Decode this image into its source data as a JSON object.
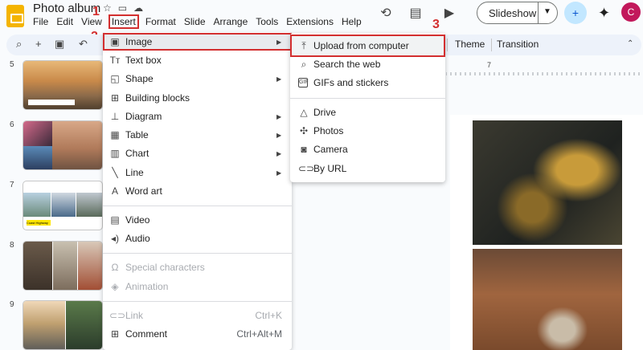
{
  "app": {
    "title": "Photo album"
  },
  "menubar": [
    "File",
    "Edit",
    "View",
    "Insert",
    "Format",
    "Slide",
    "Arrange",
    "Tools",
    "Extensions",
    "Help"
  ],
  "header": {
    "slideshow_label": "Slideshow",
    "avatar_initial": "C"
  },
  "toolbar": {
    "theme_label": "Theme",
    "transition_label": "Transition"
  },
  "steps": [
    "1",
    "2",
    "3"
  ],
  "ruler": {
    "mark": "7"
  },
  "slides": [
    {
      "number": "5"
    },
    {
      "number": "6"
    },
    {
      "number": "7",
      "caption": "Coast Highway"
    },
    {
      "number": "8"
    },
    {
      "number": "9"
    }
  ],
  "insert_menu": {
    "items": [
      {
        "label": "Image",
        "icon": "image-icon",
        "submenu": true,
        "highlighted": true
      },
      {
        "label": "Text box",
        "icon": "text-box-icon"
      },
      {
        "label": "Shape",
        "icon": "shape-icon",
        "submenu": true
      },
      {
        "label": "Building blocks",
        "icon": "building-blocks-icon"
      },
      {
        "label": "Diagram",
        "icon": "diagram-icon",
        "submenu": true
      },
      {
        "label": "Table",
        "icon": "table-icon",
        "submenu": true
      },
      {
        "label": "Chart",
        "icon": "chart-icon",
        "submenu": true
      },
      {
        "label": "Line",
        "icon": "line-icon",
        "submenu": true
      },
      {
        "label": "Word art",
        "icon": "word-art-icon"
      },
      {
        "label": "Video",
        "icon": "video-icon"
      },
      {
        "label": "Audio",
        "icon": "audio-icon"
      },
      {
        "label": "Special characters",
        "icon": "omega-icon",
        "disabled": true
      },
      {
        "label": "Animation",
        "icon": "animation-icon",
        "disabled": true
      },
      {
        "label": "Link",
        "icon": "link-icon",
        "shortcut": "Ctrl+K",
        "disabled": true
      },
      {
        "label": "Comment",
        "icon": "comment-icon",
        "shortcut": "Ctrl+Alt+M"
      }
    ]
  },
  "image_submenu": {
    "items": [
      {
        "label": "Upload from computer",
        "icon": "upload-icon",
        "highlighted": true
      },
      {
        "label": "Search the web",
        "icon": "search-icon"
      },
      {
        "label": "GIFs and stickers",
        "icon": "gif-icon"
      },
      {
        "label": "Drive",
        "icon": "drive-icon"
      },
      {
        "label": "Photos",
        "icon": "photos-icon"
      },
      {
        "label": "Camera",
        "icon": "camera-icon"
      },
      {
        "label": "By URL",
        "icon": "link-icon"
      }
    ]
  }
}
